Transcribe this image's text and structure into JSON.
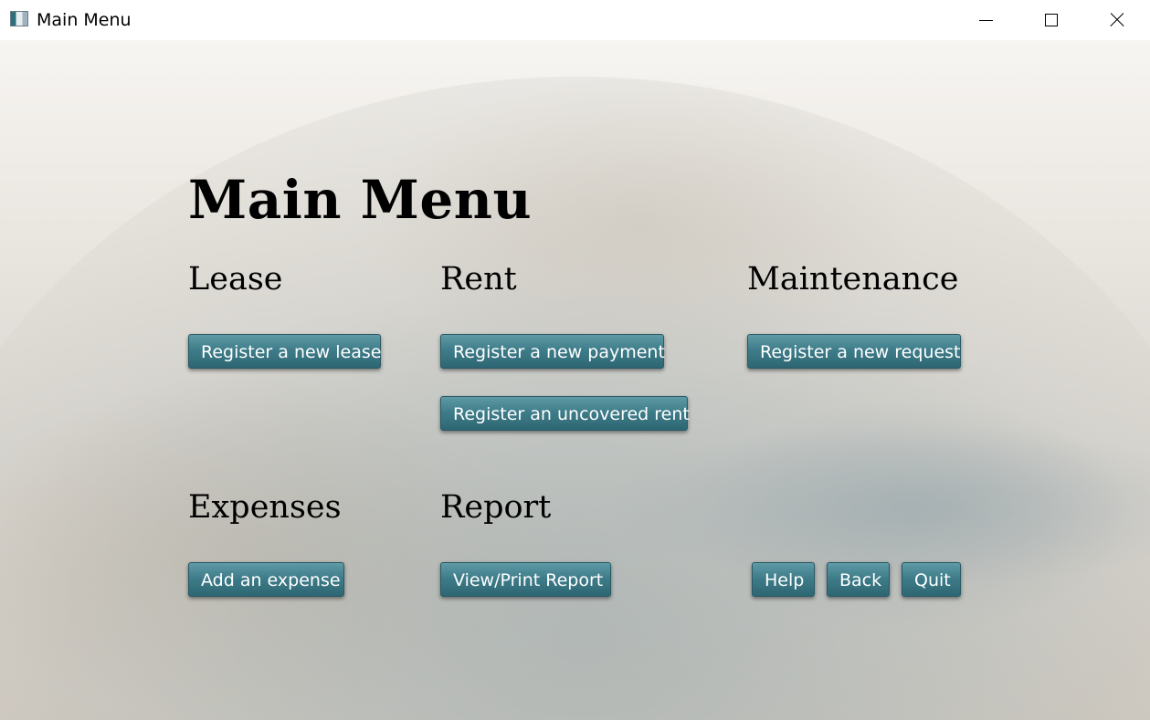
{
  "window": {
    "title": "Main Menu",
    "controls": {
      "minimize_icon": "minimize-icon",
      "maximize_icon": "maximize-icon",
      "close_icon": "close-icon"
    }
  },
  "main": {
    "title": "Main Menu",
    "sections": {
      "lease": {
        "title": "Lease",
        "buttons": [
          "Register a new lease"
        ]
      },
      "rent": {
        "title": "Rent",
        "buttons": [
          "Register a new payment",
          "Register an uncovered rent"
        ]
      },
      "maintenance": {
        "title": "Maintenance",
        "buttons": [
          "Register a new request"
        ]
      },
      "expenses": {
        "title": "Expenses",
        "buttons": [
          "Add an expense"
        ]
      },
      "report": {
        "title": "Report",
        "buttons": [
          "View/Print Report"
        ]
      }
    },
    "actions": {
      "help": "Help",
      "back": "Back",
      "quit": "Quit"
    }
  },
  "colors": {
    "button_accent": "#3f7d8a",
    "button_text": "#ffffff"
  }
}
